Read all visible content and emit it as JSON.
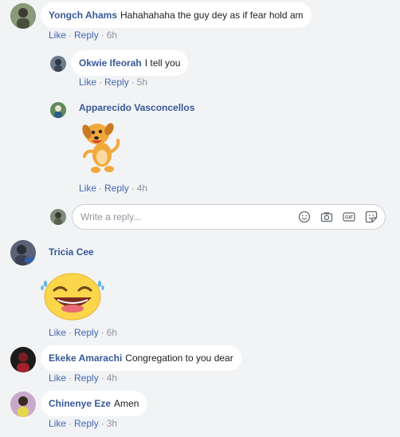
{
  "comments": [
    {
      "author": "Yongch Ahams",
      "text": "Hahahahaha the guy dey as if fear hold am",
      "actions": {
        "like": "Like",
        "reply": "Reply",
        "time": "6h"
      }
    },
    {
      "author": "Okwie Ifeorah",
      "text": "I tell you",
      "actions": {
        "like": "Like",
        "reply": "Reply",
        "time": "5h"
      }
    },
    {
      "author": "Apparecido Vasconcellos",
      "sticker": "dancing-dog-sticker",
      "actions": {
        "like": "Like",
        "reply": "Reply",
        "time": "4h"
      }
    },
    {
      "author": "Tricia Cee",
      "sticker": "laughing-emoji-sticker",
      "actions": {
        "like": "Like",
        "reply": "Reply",
        "time": "6h"
      }
    },
    {
      "author": "Ekeke Amarachi",
      "text": "Congregation to you dear",
      "actions": {
        "like": "Like",
        "reply": "Reply",
        "time": "4h"
      }
    },
    {
      "author": "Chinenye Eze",
      "text": "Amen",
      "actions": {
        "like": "Like",
        "reply": "Reply",
        "time": "3h"
      }
    }
  ],
  "reply_box": {
    "placeholder": "Write a reply...",
    "icons": [
      "emoji-icon",
      "camera-icon",
      "gif-icon",
      "sticker-icon"
    ]
  },
  "colors": {
    "background": "#f2f3f5",
    "author_link": "#385898",
    "action_link": "#4267b2",
    "meta_text": "#90949c",
    "bubble": "#ffffff"
  }
}
